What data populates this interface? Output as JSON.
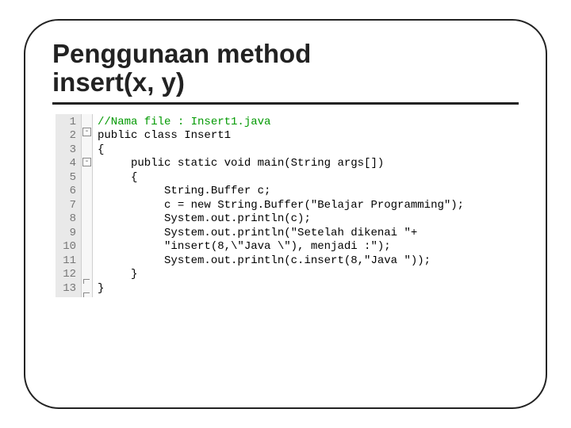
{
  "title_line1": "Penggunaan method",
  "title_line2": "insert(x, y)",
  "lines": {
    "n1": "1",
    "n2": "2",
    "n3": "3",
    "n4": "4",
    "n5": "5",
    "n6": "6",
    "n7": "7",
    "n8": "8",
    "n9": "9",
    "n10": "10",
    "n11": "11",
    "n12": "12",
    "n13": "13"
  },
  "fold": {
    "f1": "-",
    "f2": "-"
  },
  "code": {
    "l1": "//Nama file : Insert1.java",
    "l2": "public class Insert1",
    "l3": "{",
    "l4": "     public static void main(String args[])",
    "l5": "     {",
    "l6": "          String.Buffer c;",
    "l7": "          c = new String.Buffer(\"Belajar Programming\");",
    "l8": "          System.out.println(c);",
    "l9": "          System.out.println(\"Setelah dikenai \"+",
    "l10": "          \"insert(8,\\\"Java \\\"), menjadi :\");",
    "l11": "          System.out.println(c.insert(8,\"Java \"));",
    "l12": "     }",
    "l13": "}"
  }
}
